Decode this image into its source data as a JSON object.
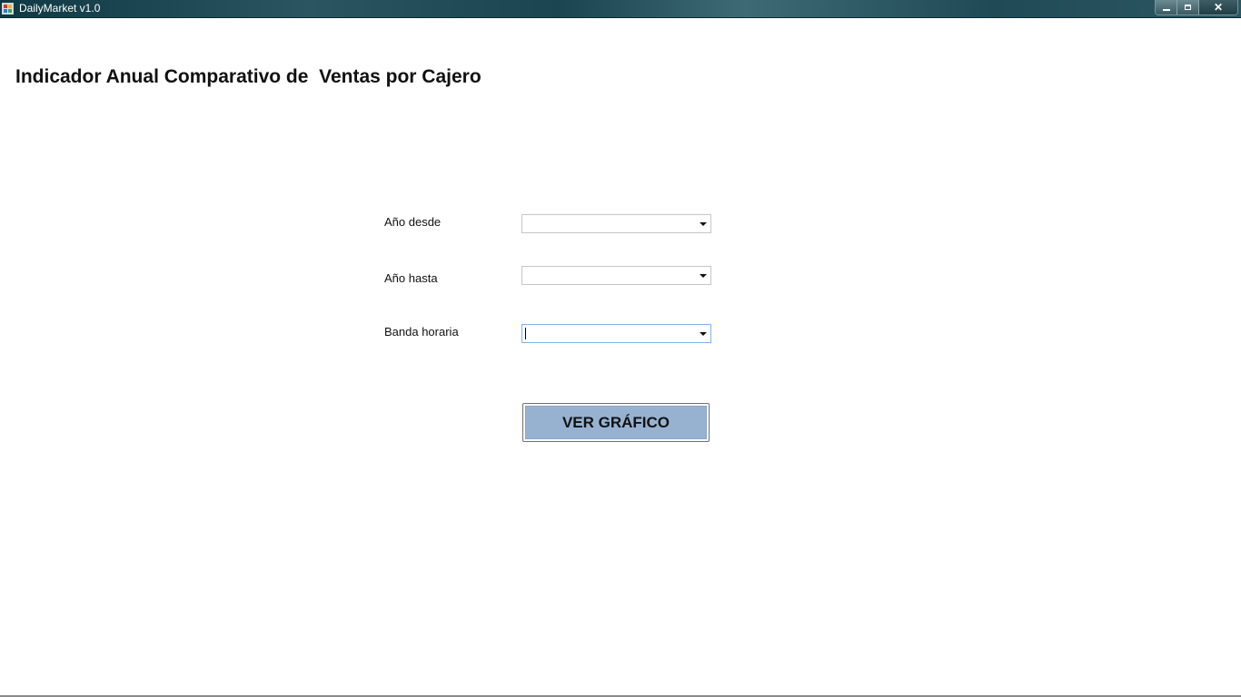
{
  "window": {
    "title": "DailyMarket v1.0",
    "controls": {
      "minimize": "minimize-icon",
      "maximize": "maximize-icon",
      "close": "✕"
    }
  },
  "page": {
    "title": "Indicador Anual Comparativo de  Ventas por Cajero"
  },
  "form": {
    "anio_desde": {
      "label": "Año desde",
      "value": ""
    },
    "anio_hasta": {
      "label": "Año hasta",
      "value": ""
    },
    "banda_horaria": {
      "label": "Banda horaria",
      "value": ""
    },
    "submit_label": "VER GRÁFICO"
  },
  "colors": {
    "titlebar": "#1f4a56",
    "button_face": "#97b2d1",
    "focus_border": "#7eb4ea"
  }
}
